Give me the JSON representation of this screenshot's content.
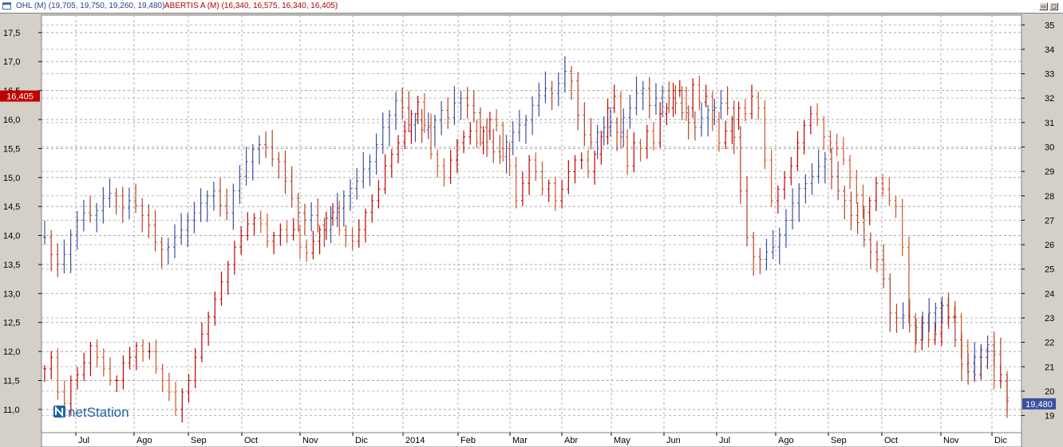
{
  "window": {
    "title_series1": "OHL (M) (19,705, 19,750, 19,260, 19,480)",
    "title_series2": "ABERTIS A (M) (16,340, 16,575, 16,340, 16,405)",
    "restore_glyph": "▭",
    "maximize_glyph": "□"
  },
  "watermark": "netStation",
  "chart_data": {
    "type": "line",
    "style": "OHLC bars",
    "x_labels": [
      "Jul",
      "Ago",
      "Sep",
      "Oct",
      "Nov",
      "Dic",
      "2014",
      "Feb",
      "Mar",
      "Abr",
      "May",
      "Jun",
      "Jul",
      "Ago",
      "Sep",
      "Oct",
      "Nov",
      "Dic"
    ],
    "y_left": {
      "ticks": [
        "11,0",
        "11,5",
        "12,0",
        "12,5",
        "13,0",
        "13,5",
        "14,0",
        "14,5",
        "15,0",
        "15,5",
        "16,0",
        "16,5",
        "17,0",
        "17,5"
      ],
      "range": [
        10.6,
        17.8
      ]
    },
    "y_right": {
      "ticks": [
        "19",
        "20",
        "21",
        "22",
        "23",
        "24",
        "25",
        "26",
        "27",
        "28",
        "29",
        "30",
        "31",
        "32",
        "33",
        "34",
        "35"
      ],
      "range": [
        18.3,
        35.4
      ]
    },
    "grid": true,
    "series": [
      {
        "name": "ABERTIS A",
        "axis": "left",
        "color": "#c00000",
        "last_label": "16,405",
        "values": [
          11.7,
          11.9,
          11.3,
          11.1,
          11.5,
          11.6,
          11.8,
          12.1,
          11.9,
          11.7,
          11.5,
          11.5,
          11.8,
          11.9,
          12.1,
          12.0,
          12.0,
          11.7,
          11.5,
          11.3,
          11.0,
          11.3,
          11.5,
          11.9,
          12.3,
          12.6,
          12.9,
          13.2,
          13.5,
          13.8,
          14.0,
          14.2,
          14.3,
          14.2,
          13.9,
          14.0,
          14.1,
          14.0,
          14.1,
          13.8,
          13.7,
          13.9,
          14.1,
          14.3,
          14.4,
          14.1,
          14.0,
          13.9,
          14.1,
          14.4,
          14.6,
          14.8,
          15.2,
          15.4,
          15.6,
          15.8,
          16.1,
          16.3,
          15.9,
          15.4,
          15.2,
          15.0,
          15.3,
          15.6,
          15.7,
          15.8,
          15.6,
          15.8,
          16.0,
          15.9,
          15.5,
          15.2,
          14.6,
          14.9,
          15.3,
          15.1,
          14.8,
          14.9,
          14.6,
          14.8,
          15.1,
          15.3,
          15.3,
          15.1,
          15.4,
          15.7,
          16.2,
          16.4,
          15.7,
          15.2,
          15.6,
          15.5,
          15.8,
          15.6,
          16.1,
          16.2,
          16.5,
          16.5,
          16.2,
          16.6,
          16.3,
          16.4,
          16.0,
          15.6,
          15.8,
          16.0,
          16.2,
          16.1,
          16.4,
          16.2,
          15.3,
          14.6,
          14.8,
          15.0,
          15.2,
          15.6,
          15.9,
          16.1,
          16.0,
          15.7,
          15.6,
          15.5,
          15.3,
          15.0,
          14.7,
          14.4,
          14.6,
          14.9,
          14.8,
          14.6,
          14.5,
          13.8,
          12.6,
          12.2,
          12.5,
          12.2,
          12.3,
          12.8,
          12.6,
          12.6,
          12.1,
          11.8,
          11.6,
          11.9,
          12.0,
          11.5,
          11.6,
          11.2
        ]
      },
      {
        "name": "OHL",
        "axis": "right",
        "color": "#3c4fa0",
        "last_label": "19,480",
        "values": [
          26.3,
          25.6,
          25.2,
          25.6,
          26.4,
          27.0,
          27.3,
          27.2,
          27.4,
          27.9,
          28.1,
          28.0,
          27.5,
          27.8,
          27.6,
          27.2,
          26.8,
          26.1,
          25.8,
          25.9,
          26.3,
          26.6,
          27.0,
          27.3,
          27.7,
          28.0,
          28.2,
          27.6,
          27.3,
          28.2,
          28.8,
          29.4,
          29.9,
          30.1,
          30.0,
          29.5,
          29.4,
          28.6,
          27.9,
          27.3,
          27.0,
          27.2,
          26.8,
          26.6,
          27.1,
          27.5,
          28.0,
          28.3,
          28.6,
          29.1,
          29.4,
          30.1,
          30.8,
          31.3,
          31.9,
          31.6,
          30.9,
          31.1,
          30.7,
          30.8,
          31.1,
          31.5,
          31.2,
          31.8,
          32.0,
          31.7,
          31.4,
          30.8,
          30.2,
          29.8,
          29.6,
          30.2,
          30.6,
          30.9,
          31.1,
          31.7,
          32.1,
          32.4,
          32.2,
          32.6,
          33.1,
          32.7,
          31.3,
          30.5,
          30.2,
          30.6,
          30.8,
          31.0,
          30.6,
          31.2,
          31.6,
          32.2,
          32.4,
          31.7,
          32.0,
          32.3,
          32.0,
          31.8,
          31.4,
          31.0,
          30.8,
          31.2,
          31.5,
          31.6,
          31.8,
          31.6,
          30.4,
          28.2,
          26.3,
          25.5,
          25.4,
          25.7,
          25.9,
          26.4,
          27.0,
          27.7,
          28.3,
          28.5,
          28.8,
          29.2,
          29.5,
          28.8,
          28.2,
          27.8,
          27.2,
          26.9,
          26.2,
          25.7,
          25.4,
          24.6,
          23.2,
          23.0,
          23.1,
          22.7,
          22.6,
          22.8,
          23.2,
          23.4,
          23.5,
          23.0,
          22.1,
          21.1,
          20.8,
          21.4,
          21.7,
          21.9,
          21.5,
          20.4,
          19.6
        ]
      }
    ]
  }
}
